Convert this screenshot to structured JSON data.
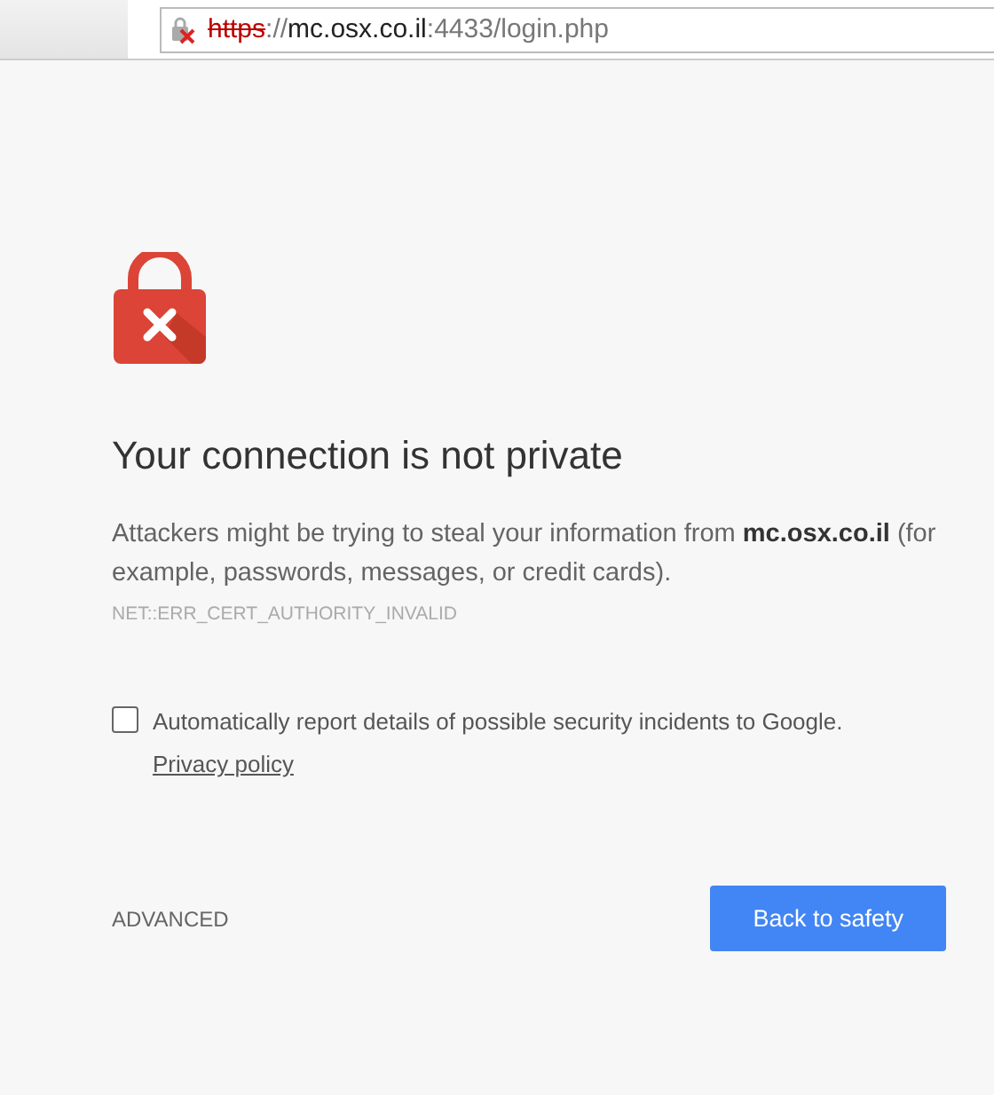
{
  "address_bar": {
    "scheme": "https",
    "separator": "://",
    "host": "mc.osx.co.il",
    "path": ":4433/login.php",
    "secure": false
  },
  "heading": "Your connection is not private",
  "explanation": "Attackers might be trying to steal your information from **mc.osx.co.il** (for example, passwords, messages, or credit cards).",
  "error_code": "NET::ERR_CERT_AUTHORITY_INVALID",
  "report_option": {
    "label": "Automatically report details of possible security incidents to Google.",
    "link": "Privacy policy",
    "checked": false
  },
  "advanced_link": "ADVANCED",
  "primary_button": "Back to safety"
}
